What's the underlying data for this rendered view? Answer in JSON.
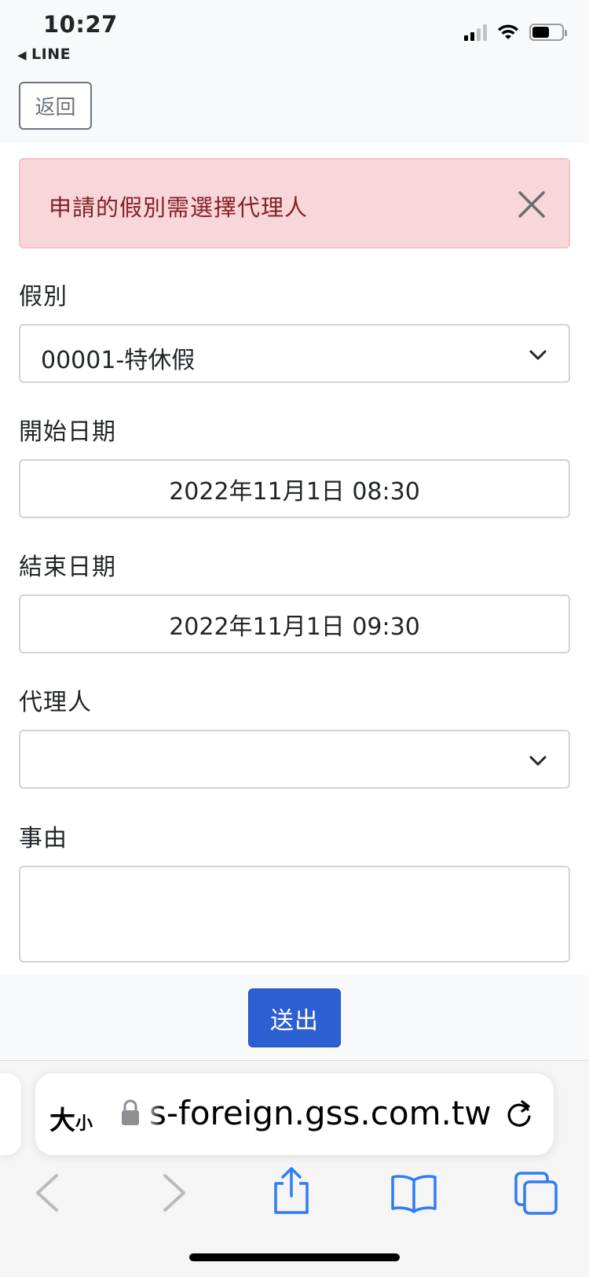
{
  "status_bar": {
    "time": "10:27",
    "back_app": "LINE"
  },
  "header": {
    "back_label": "返回"
  },
  "alert": {
    "message": "申請的假別需選擇代理人"
  },
  "form": {
    "leave_type": {
      "label": "假別",
      "value": "00001-特休假"
    },
    "start_date": {
      "label": "開始日期",
      "value": "2022年11月1日 08:30"
    },
    "end_date": {
      "label": "結束日期",
      "value": "2022年11月1日 09:30"
    },
    "agent": {
      "label": "代理人",
      "value": ""
    },
    "reason": {
      "label": "事由",
      "value": ""
    },
    "submit_label": "送出"
  },
  "browser": {
    "text_size_big": "大",
    "text_size_small": "小",
    "url": "s-foreign.gss.com.tw",
    "accent_color": "#2f7cf6"
  },
  "colors": {
    "alert_bg": "#f8d7da",
    "alert_text": "#842029",
    "primary": "#2c5fd2"
  }
}
